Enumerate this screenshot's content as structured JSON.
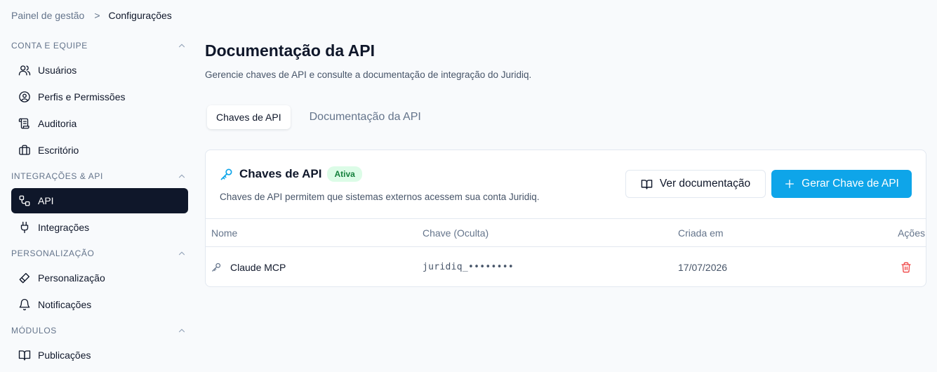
{
  "breadcrumb": {
    "parent": "Painel de gestão",
    "separator": ">",
    "current": "Configurações"
  },
  "sidebar": {
    "sections": [
      {
        "title": "CONTA E EQUIPE",
        "items": [
          {
            "label": "Usuários",
            "icon": "users-icon"
          },
          {
            "label": "Perfis e Permissões",
            "icon": "user-circle-icon"
          },
          {
            "label": "Auditoria",
            "icon": "scroll-icon"
          },
          {
            "label": "Escritório",
            "icon": "briefcase-icon"
          }
        ]
      },
      {
        "title": "INTEGRAÇÕES & API",
        "items": [
          {
            "label": "API",
            "icon": "route-icon",
            "active": true
          },
          {
            "label": "Integrações",
            "icon": "plug-icon"
          }
        ]
      },
      {
        "title": "PERSONALIZAÇÃO",
        "items": [
          {
            "label": "Personalização",
            "icon": "brush-icon"
          },
          {
            "label": "Notificações",
            "icon": "bell-icon"
          }
        ]
      },
      {
        "title": "MÓDULOS",
        "items": [
          {
            "label": "Publicações",
            "icon": "book-icon"
          }
        ]
      }
    ]
  },
  "page": {
    "title": "Documentação da API",
    "subtitle": "Gerencie chaves de API e consulte a documentação de integração do Juridiq."
  },
  "tabs": [
    {
      "label": "Chaves de API",
      "active": true
    },
    {
      "label": "Documentação da API",
      "active": false
    }
  ],
  "card": {
    "title": "Chaves de API",
    "badge": "Ativa",
    "description": "Chaves de API permitem que sistemas externos acessem sua conta Juridiq.",
    "view_docs_label": "Ver documentação",
    "generate_label": "Gerar Chave de API",
    "table": {
      "headers": {
        "name": "Nome",
        "key": "Chave (Oculta)",
        "created": "Criada em",
        "actions": "Ações"
      },
      "rows": [
        {
          "name": "Claude MCP",
          "key": "juridiq_••••••••",
          "created": "17/07/2026"
        }
      ]
    }
  },
  "colors": {
    "accent": "#0ea5e9",
    "active_nav": "#0f172a",
    "badge_bg": "#dcfce7",
    "badge_text": "#15803d",
    "danger": "#ef4444"
  }
}
